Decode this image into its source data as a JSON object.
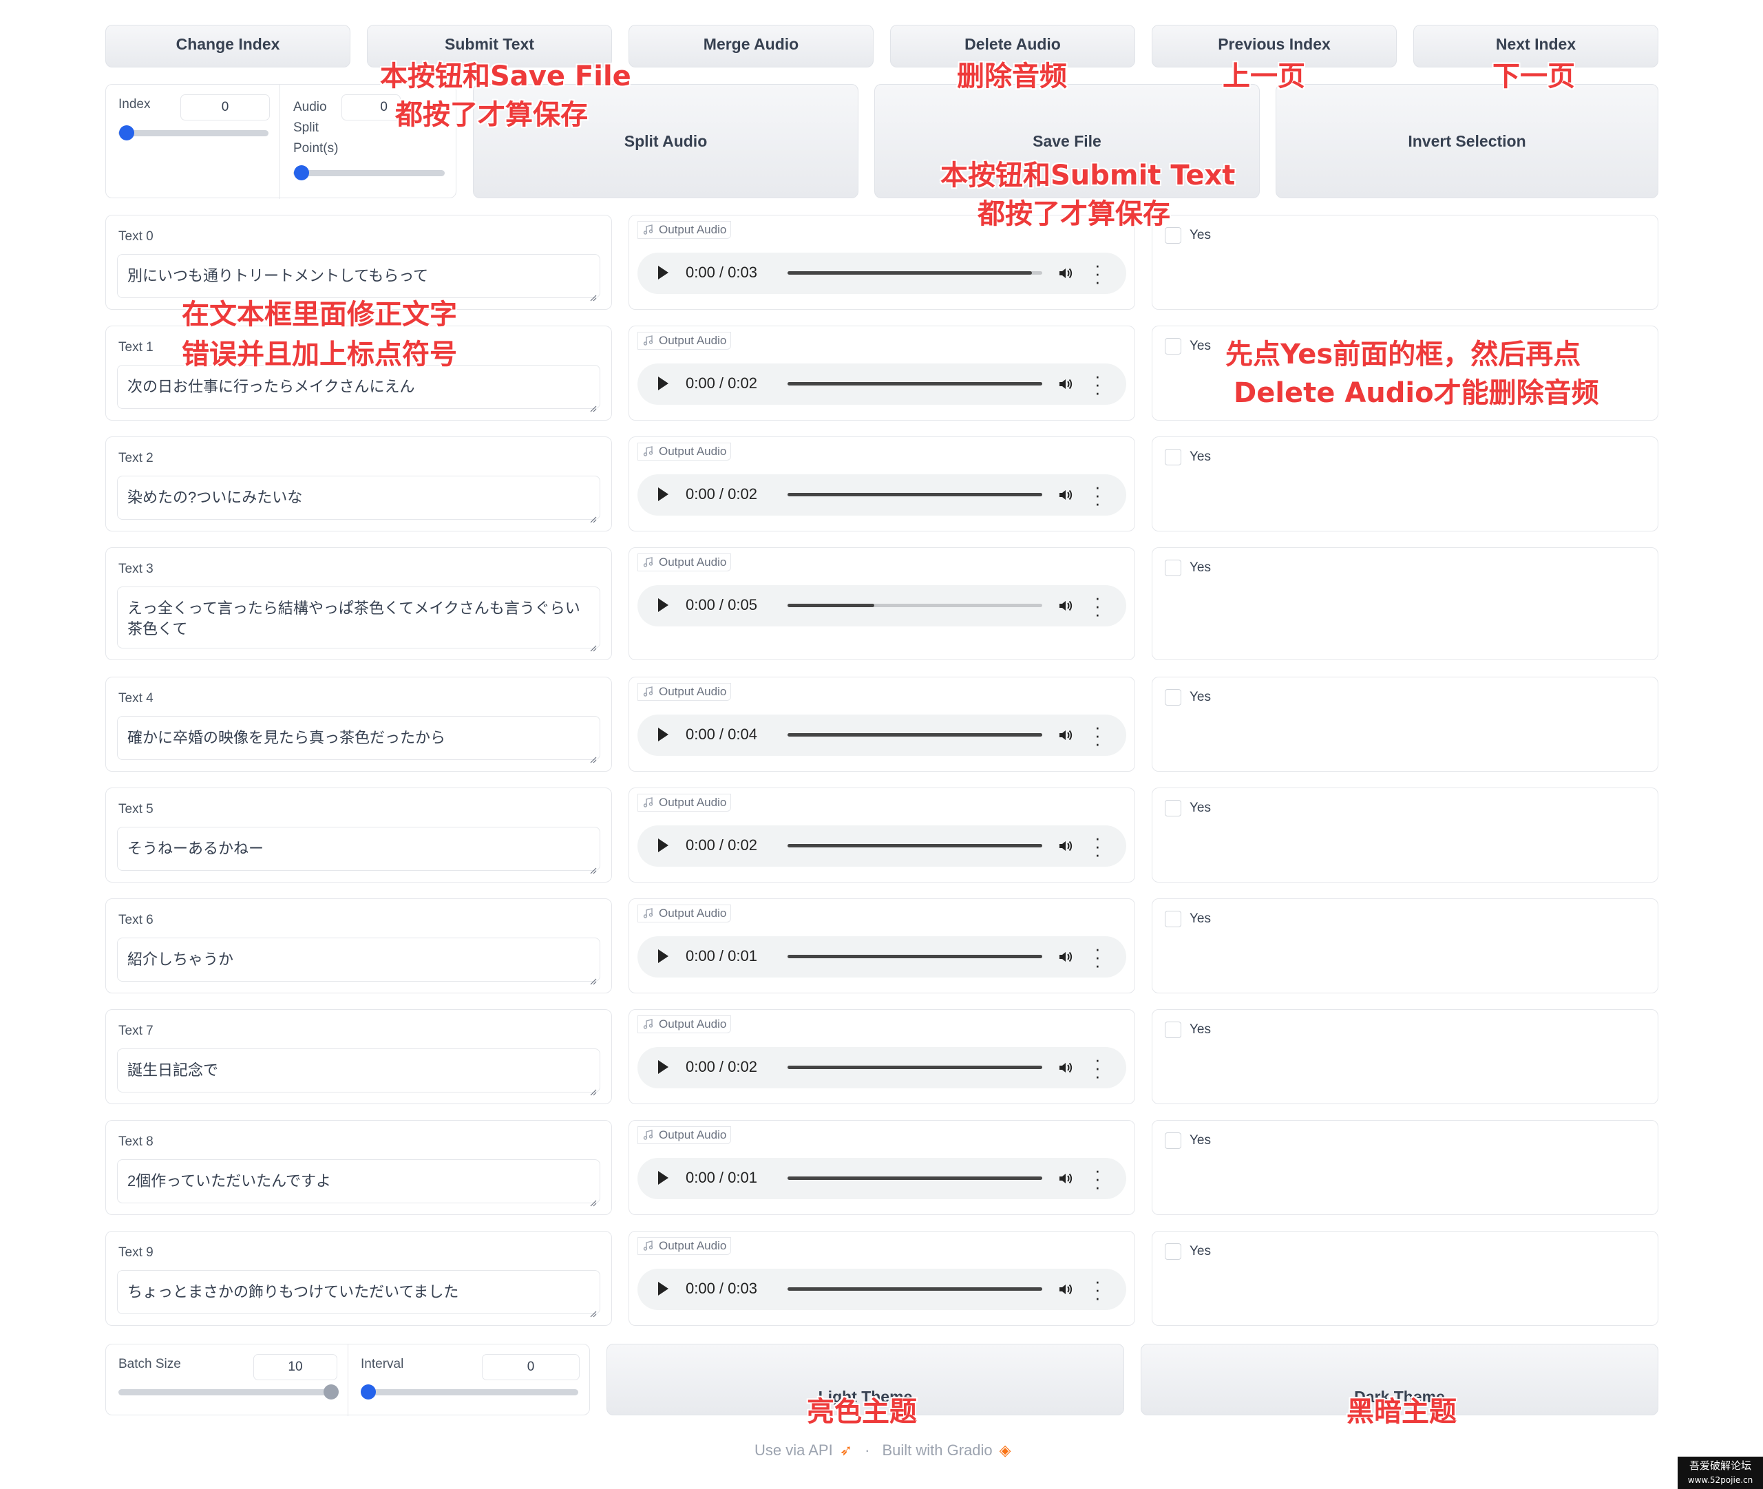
{
  "toolbar": {
    "change_index": "Change Index",
    "submit_text": "Submit Text",
    "merge_audio": "Merge Audio",
    "delete_audio": "Delete Audio",
    "previous_index": "Previous Index",
    "next_index": "Next Index"
  },
  "controls": {
    "index_label": "Index",
    "index_value": "0",
    "index_level": 0,
    "split_label_1": "Audio",
    "split_label_2": "Split",
    "split_label_3": "Point(s)",
    "split_value": "0",
    "split_level": 0,
    "split_audio": "Split Audio",
    "save_file": "Save File",
    "invert_selection": "Invert Selection"
  },
  "rows": [
    {
      "label": "Text 0",
      "text": "別にいつも通りトリートメントしてもらって",
      "audio_label": "Output Audio",
      "time": "0:00 / 0:03",
      "progress": 0.96,
      "checkbox": "Yes"
    },
    {
      "label": "Text 1",
      "text": "次の日お仕事に行ったらメイクさんにえん",
      "audio_label": "Output Audio",
      "time": "0:00 / 0:02",
      "progress": 1.0,
      "checkbox": "Yes"
    },
    {
      "label": "Text 2",
      "text": "染めたの?ついにみたいな",
      "audio_label": "Output Audio",
      "time": "0:00 / 0:02",
      "progress": 1.0,
      "checkbox": "Yes"
    },
    {
      "label": "Text 3",
      "text": "えっ全くって言ったら結構やっぱ茶色くてメイクさんも言うぐらい茶色くて",
      "audio_label": "Output Audio",
      "time": "0:00 / 0:05",
      "progress": 0.34,
      "checkbox": "Yes"
    },
    {
      "label": "Text 4",
      "text": "確かに卒婚の映像を見たら真っ茶色だったから",
      "audio_label": "Output Audio",
      "time": "0:00 / 0:04",
      "progress": 1.0,
      "checkbox": "Yes"
    },
    {
      "label": "Text 5",
      "text": "そうねーあるかねー",
      "audio_label": "Output Audio",
      "time": "0:00 / 0:02",
      "progress": 1.0,
      "checkbox": "Yes"
    },
    {
      "label": "Text 6",
      "text": "紹介しちゃうか",
      "audio_label": "Output Audio",
      "time": "0:00 / 0:01",
      "progress": 1.0,
      "checkbox": "Yes"
    },
    {
      "label": "Text 7",
      "text": "誕生日記念で",
      "audio_label": "Output Audio",
      "time": "0:00 / 0:02",
      "progress": 1.0,
      "checkbox": "Yes"
    },
    {
      "label": "Text 8",
      "text": "2個作っていただいたんですよ",
      "audio_label": "Output Audio",
      "time": "0:00 / 0:01",
      "progress": 1.0,
      "checkbox": "Yes"
    },
    {
      "label": "Text 9",
      "text": "ちょっとまさかの飾りもつけていただいてました",
      "audio_label": "Output Audio",
      "time": "0:00 / 0:03",
      "progress": 1.0,
      "checkbox": "Yes"
    }
  ],
  "bottom": {
    "batch_label": "Batch Size",
    "batch_value": "10",
    "batch_level": 1.0,
    "interval_label": "Interval",
    "interval_value": "0",
    "interval_level": 0,
    "light_theme": "Light Theme",
    "dark_theme": "Dark Theme"
  },
  "footer": {
    "api": "Use via API",
    "dot": "·",
    "built": "Built with Gradio"
  },
  "annotations": {
    "submit_1": "本按钮和Save File",
    "submit_2": "都按了才算保存",
    "delete": "删除音频",
    "prev": "上一页",
    "next": "下一页",
    "save_1": "本按钮和Submit Text",
    "save_2": "都按了才算保存",
    "text_1": "在文本框里面修正文字",
    "text_2": "错误并且加上标点符号",
    "yes_1": "先点Yes前面的框，然后再点",
    "yes_2": "Delete Audio才能删除音频",
    "light": "亮色主题",
    "dark": "黑暗主题"
  },
  "watermark": {
    "line1": "吾爱破解论坛",
    "line2": "www.52pojie.cn"
  },
  "colors": {
    "accent": "#2563eb",
    "annotation": "#ee3a3a",
    "gradio": "#f97316"
  }
}
